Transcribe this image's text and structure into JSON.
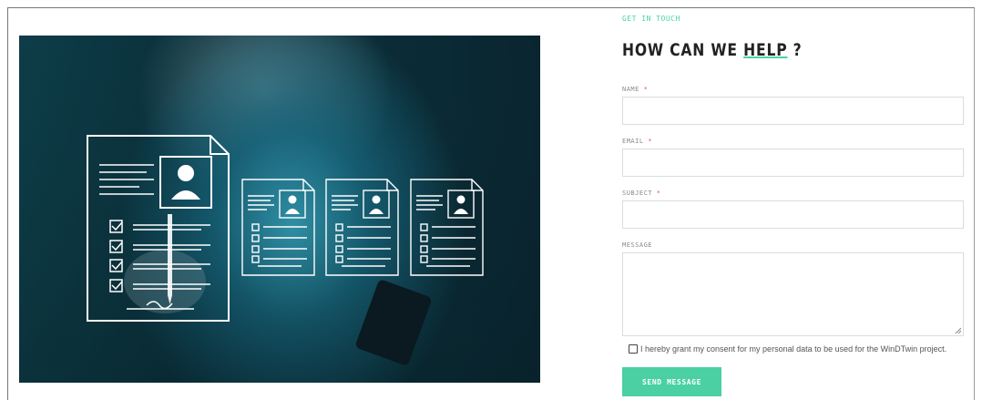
{
  "form": {
    "eyebrow": "GET IN TOUCH",
    "heading_pre": "HOW CAN WE ",
    "heading_underlined": "HELP",
    "heading_post": " ?",
    "name_label": "NAME",
    "email_label": "EMAIL",
    "subject_label": "SUBJECT",
    "message_label": "MESSAGE",
    "required_mark": "*",
    "name_value": "",
    "email_value": "",
    "subject_value": "",
    "message_value": "",
    "consent_text": "I hereby grant my consent for my personal data to be used for the WinDTwin project.",
    "consent_checked": false,
    "submit_label": "SEND MESSAGE"
  },
  "hero": {
    "icon": "resume-documents-icon"
  },
  "colors": {
    "accent": "#4ad0a2",
    "required": "#e05555",
    "heading": "#222222"
  }
}
